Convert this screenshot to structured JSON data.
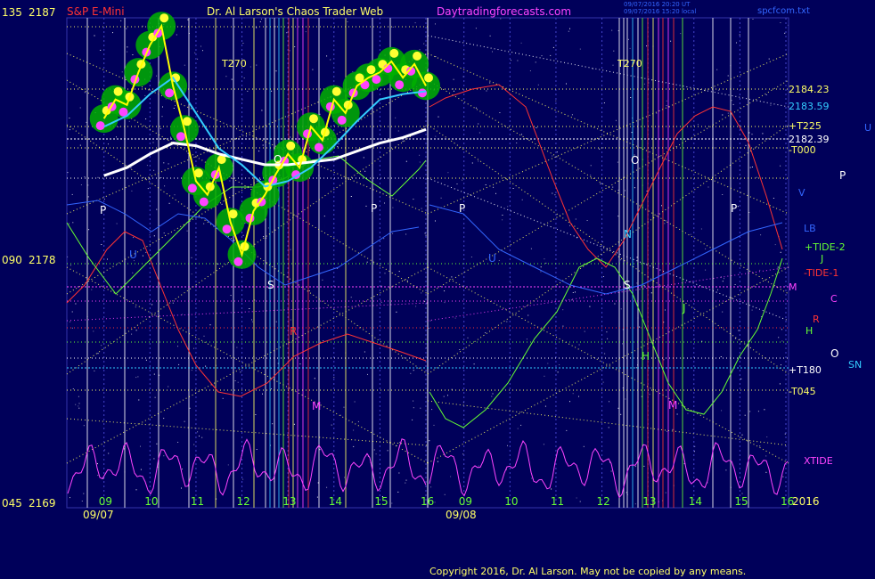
{
  "chart_data": {
    "type": "line",
    "title": "Dr. Al Larson's Chaos Trader Web",
    "instrument": "S&P E-Mini",
    "site": "Daytradingforecasts.com",
    "file": "spcfcom.txt",
    "timestamps": [
      "09/07/2016 20:20 UT",
      "09/07/2016 15:20 local"
    ],
    "copyright": "Copyright 2016, Dr. Al Larson. May not be copied by any means.",
    "colors": {
      "background": "#00005a",
      "price": "#ffff00",
      "ma_fast": "#33ccff",
      "ma_slow": "#ffffff",
      "band": "#00c000",
      "xtide": "#ff44ff"
    },
    "y_axis_left": [
      {
        "code": "135",
        "price": "2187"
      },
      {
        "code": "090",
        "price": "2178"
      },
      {
        "code": "045",
        "price": "2169"
      }
    ],
    "ylim": [
      2169,
      2187
    ],
    "x_ticks": [
      "09",
      "10",
      "11",
      "12",
      "13",
      "14",
      "15",
      "16",
      "09",
      "10",
      "11",
      "12",
      "13",
      "14",
      "15",
      "16"
    ],
    "x_dates": [
      "09/07",
      "09/08"
    ],
    "year": "2016",
    "t270": [
      "T270",
      "T270"
    ],
    "right_levels": [
      {
        "label": "2184.23",
        "color": "#ffff66"
      },
      {
        "label": "2183.59",
        "color": "#33ccff"
      },
      {
        "label": "+T225",
        "color": "#ffff66"
      },
      {
        "label": "2182.39",
        "color": "#ffffff"
      },
      {
        "label": "-T000",
        "color": "#ffff66"
      },
      {
        "label": "LB",
        "color": "#3366ff"
      },
      {
        "label": "+TIDE-2",
        "color": "#66ff33"
      },
      {
        "label": "J",
        "color": "#66ff33"
      },
      {
        "label": "-TIDE-1",
        "color": "#ff3333"
      },
      {
        "label": "M",
        "color": "#ff44ff"
      },
      {
        "label": "C",
        "color": "#ff44ff"
      },
      {
        "label": "R",
        "color": "#ff3333"
      },
      {
        "label": "H",
        "color": "#66ff33"
      },
      {
        "label": "O",
        "color": "#ffffff"
      },
      {
        "label": "SN",
        "color": "#33ccff"
      },
      {
        "label": "+T180",
        "color": "#ffffff"
      },
      {
        "label": "-T045",
        "color": "#ffff66"
      },
      {
        "label": "XTIDE",
        "color": "#ff44ff"
      },
      {
        "label": "U",
        "color": "#3366ff"
      },
      {
        "label": "P",
        "color": "#ffffff"
      },
      {
        "label": "V",
        "color": "#3366ff"
      }
    ],
    "markers": [
      "P",
      "P",
      "P",
      "P",
      "O",
      "O",
      "S",
      "S",
      "N",
      "R",
      "M",
      "M",
      "U",
      "U",
      "J",
      "H"
    ],
    "series": [
      {
        "name": "price",
        "x": [
          9.0,
          9.25,
          9.5,
          9.75,
          10.0,
          10.25,
          10.5,
          10.75,
          11.0,
          11.25,
          11.5,
          11.75,
          12.0,
          12.25,
          12.5,
          12.75,
          13.0,
          13.25,
          13.5,
          13.75,
          14.0,
          14.25,
          14.5,
          14.75,
          15.0,
          15.25,
          15.5,
          15.75,
          16.0
        ],
        "values": [
          2183.3,
          2184.0,
          2183.8,
          2185.0,
          2186.0,
          2186.7,
          2184.5,
          2182.9,
          2181.0,
          2180.5,
          2181.5,
          2179.5,
          2178.3,
          2179.9,
          2180.5,
          2181.3,
          2182.0,
          2181.5,
          2183.0,
          2182.5,
          2184.0,
          2183.5,
          2184.5,
          2184.8,
          2185.0,
          2185.4,
          2184.8,
          2185.3,
          2184.5
        ]
      },
      {
        "name": "ma_fast",
        "x": [
          9.0,
          9.5,
          10.0,
          10.5,
          11.0,
          11.5,
          12.0,
          12.5,
          13.0,
          13.5,
          14.0,
          14.5,
          15.0,
          15.5,
          16.0
        ],
        "values": [
          2183.0,
          2183.4,
          2184.2,
          2184.8,
          2183.5,
          2182.2,
          2181.6,
          2180.8,
          2181.0,
          2181.5,
          2182.3,
          2183.2,
          2184.0,
          2184.2,
          2184.3
        ]
      },
      {
        "name": "ma_slow",
        "x": [
          9.0,
          9.5,
          10.0,
          10.5,
          11.0,
          11.5,
          12.0,
          12.5,
          13.0,
          13.5,
          14.0,
          14.5,
          15.0,
          15.5,
          16.0
        ],
        "values": [
          2181.2,
          2181.5,
          2182.0,
          2182.4,
          2182.3,
          2182.0,
          2181.8,
          2181.6,
          2181.6,
          2181.7,
          2181.8,
          2182.1,
          2182.4,
          2182.6,
          2182.9
        ]
      }
    ]
  }
}
